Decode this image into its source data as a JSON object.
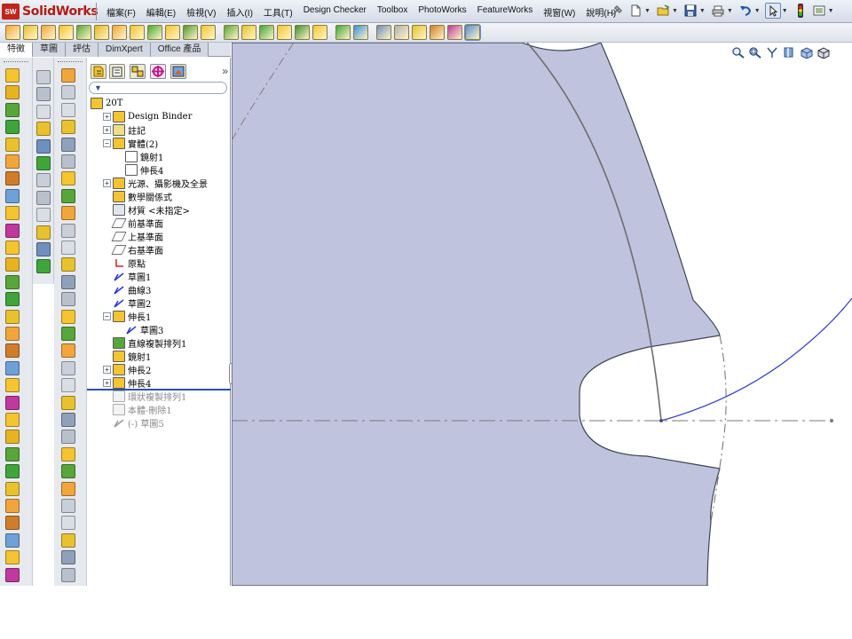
{
  "app": {
    "logo_text": "SolidWorks",
    "logo_badge": "SW"
  },
  "menus": [
    {
      "label": "檔案(F)"
    },
    {
      "label": "編輯(E)"
    },
    {
      "label": "檢視(V)"
    },
    {
      "label": "插入(I)"
    },
    {
      "label": "工具(T)"
    },
    {
      "label": "Design Checker"
    },
    {
      "label": "Toolbox"
    },
    {
      "label": "PhotoWorks"
    },
    {
      "label": "FeatureWorks"
    },
    {
      "label": "視窗(W)"
    },
    {
      "label": "說明(H)"
    }
  ],
  "tabs": [
    {
      "label": "特徵"
    },
    {
      "label": "草圖"
    },
    {
      "label": "評估"
    },
    {
      "label": "DimXpert"
    },
    {
      "label": "Office 產品"
    }
  ],
  "feature_tree": {
    "more_glyph": "»",
    "filter_glyph": "▼",
    "nodes": [
      {
        "label": "20T",
        "expander": "",
        "icon": "part-icon"
      },
      {
        "label": "Design Binder",
        "expander": "+",
        "icon": "design-binder-icon"
      },
      {
        "label": "註記",
        "expander": "+",
        "icon": "annotations-icon"
      },
      {
        "label": "實體(2)",
        "expander": "−",
        "icon": "solid-bodies-icon"
      },
      {
        "label": "鏡射1",
        "expander": "",
        "icon": "body-icon"
      },
      {
        "label": "伸長4",
        "expander": "",
        "icon": "body-icon"
      },
      {
        "label": "光源、攝影機及全景",
        "expander": "+",
        "icon": "lights-icon"
      },
      {
        "label": "數學關係式",
        "expander": "",
        "icon": "equations-icon"
      },
      {
        "label": "材質 <未指定>",
        "expander": "",
        "icon": "material-icon"
      },
      {
        "label": "前基準面",
        "expander": "",
        "icon": "plane-icon"
      },
      {
        "label": "上基準面",
        "expander": "",
        "icon": "plane-icon"
      },
      {
        "label": "右基準面",
        "expander": "",
        "icon": "plane-icon"
      },
      {
        "label": "原點",
        "expander": "",
        "icon": "origin-icon"
      },
      {
        "label": "草圖1",
        "expander": "",
        "icon": "sketch-icon"
      },
      {
        "label": "曲線3",
        "expander": "",
        "icon": "curve-icon"
      },
      {
        "label": "草圖2",
        "expander": "",
        "icon": "sketch-icon"
      },
      {
        "label": "伸長1",
        "expander": "−",
        "icon": "extrude-icon"
      },
      {
        "label": "草圖3",
        "expander": "",
        "icon": "sketch-icon"
      },
      {
        "label": "直線複製排列1",
        "expander": "",
        "icon": "linear-pattern-icon"
      },
      {
        "label": "鏡射1",
        "expander": "",
        "icon": "mirror-icon"
      },
      {
        "label": "伸長2",
        "expander": "+",
        "icon": "extrude-icon"
      },
      {
        "label": "伸長4",
        "expander": "+",
        "icon": "extrude-icon"
      },
      {
        "label": "環狀複製排列1",
        "expander": "",
        "icon": "circular-pattern-icon"
      },
      {
        "label": "本體-刪除1",
        "expander": "",
        "icon": "delete-body-icon"
      },
      {
        "label": "(-) 草圖5",
        "expander": "",
        "icon": "sketch-icon"
      }
    ]
  },
  "colors": {
    "gear_fill": "#c0c3de",
    "gear_edge": "#3d4356",
    "sketch_curve": "#2a36d8",
    "centerline": "#7a7a7a"
  }
}
